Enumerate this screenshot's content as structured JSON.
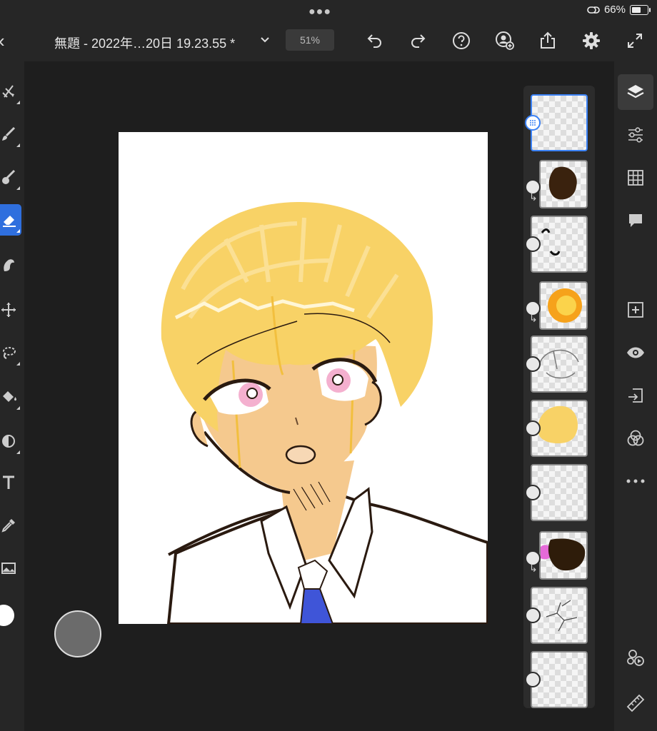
{
  "status": {
    "battery_percent": "66%"
  },
  "header": {
    "back_label": "‹",
    "document_title": "無題 - 2022年…20日 19.23.55 *",
    "zoom": "51%",
    "icons": [
      "undo-icon",
      "redo-icon",
      "help-icon",
      "invite-icon",
      "share-icon",
      "settings-icon",
      "fullscreen-icon"
    ]
  },
  "brush": {
    "size": "209"
  },
  "left_tools": [
    "selection-tool-icon",
    "brush-tool-icon",
    "mixer-brush-icon",
    "eraser-tool-icon",
    "smudge-tool-icon",
    "move-tool-icon",
    "lasso-tool-icon",
    "fill-tool-icon",
    "clone-stamp-icon",
    "type-tool-icon",
    "eyedropper-icon",
    "place-image-icon",
    "color-swatch"
  ],
  "layers": [
    {
      "id": 1,
      "selected": true,
      "clipped": false,
      "content": "empty"
    },
    {
      "id": 2,
      "selected": false,
      "clipped": true,
      "content": "dark-brown-blob"
    },
    {
      "id": 3,
      "selected": false,
      "clipped": false,
      "content": "eye-lines"
    },
    {
      "id": 4,
      "selected": false,
      "clipped": true,
      "content": "orange-circle"
    },
    {
      "id": 5,
      "selected": false,
      "clipped": false,
      "content": "sketch-lines"
    },
    {
      "id": 6,
      "selected": false,
      "clipped": false,
      "content": "yellow-hair"
    },
    {
      "id": 7,
      "selected": false,
      "clipped": false,
      "content": "empty"
    },
    {
      "id": 8,
      "selected": false,
      "clipped": true,
      "content": "pink-dark-blob"
    },
    {
      "id": 9,
      "selected": false,
      "clipped": false,
      "content": "crack-lines"
    },
    {
      "id": 10,
      "selected": false,
      "clipped": false,
      "content": "empty"
    }
  ],
  "right_tools": [
    "layers-icon",
    "adjustments-icon",
    "grid-icon",
    "comment-icon",
    "add-layer-icon",
    "visibility-icon",
    "import-icon",
    "blend-mode-icon",
    "more-icon",
    "livestream-icon",
    "ruler-icon"
  ],
  "colors": {
    "accent": "#2f6fde",
    "hair": "#f8d266",
    "skin": "#f5c98e",
    "tie": "#3f55d8",
    "line": "#2a1a10"
  }
}
